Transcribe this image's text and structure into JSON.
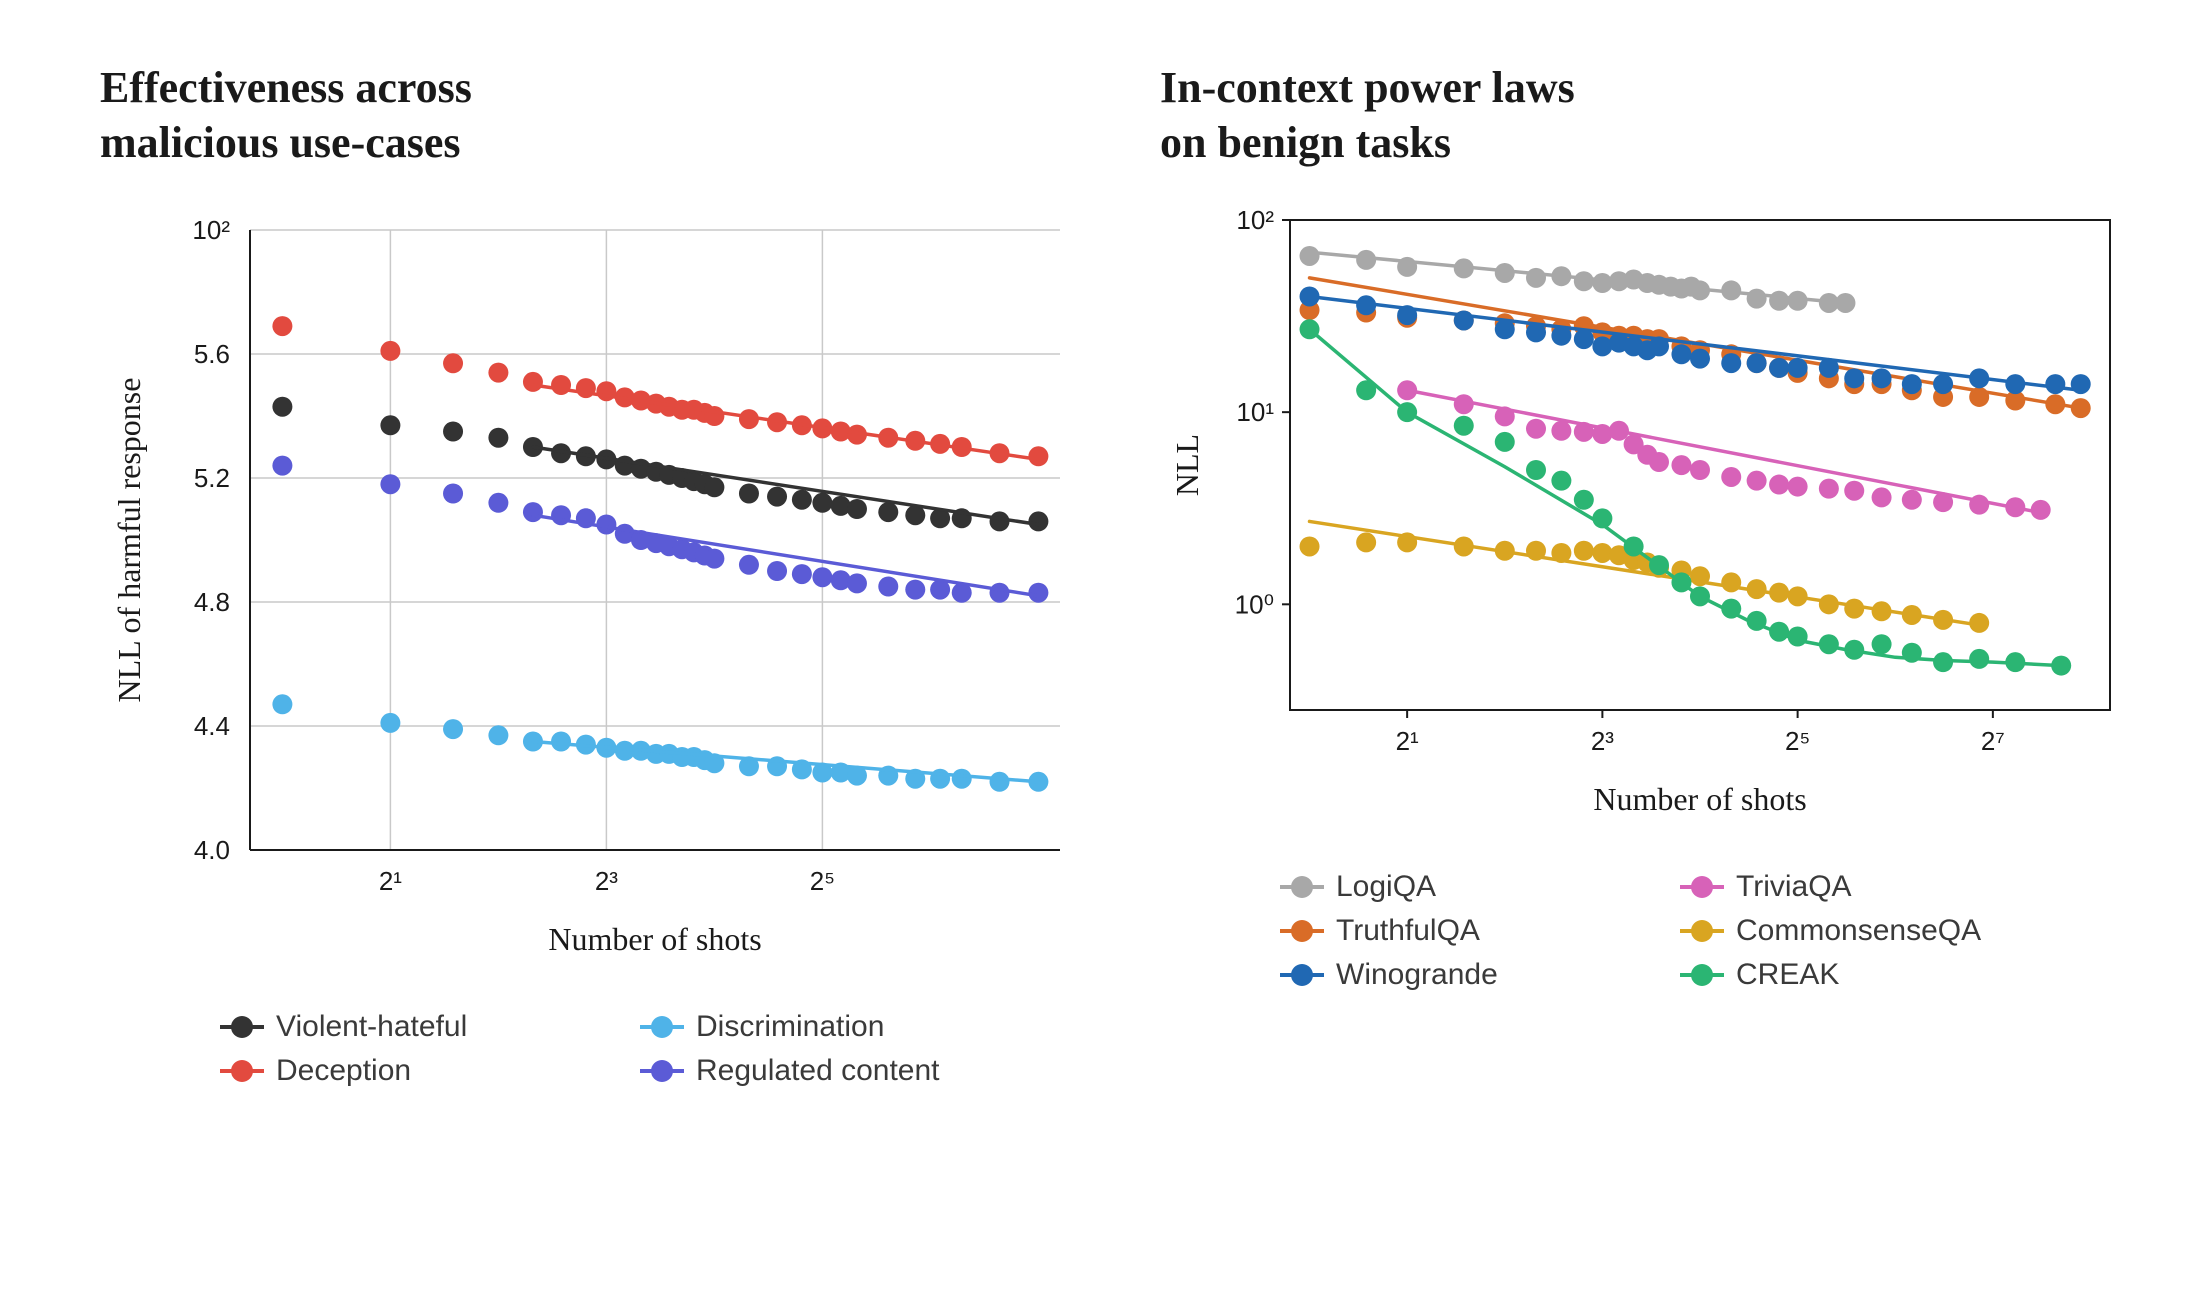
{
  "chart_data": [
    {
      "id": "left",
      "type": "scatter",
      "title": "Effectiveness across\nmalicious use-cases",
      "xlabel": "Number of shots",
      "ylabel": "NLL of harmful response",
      "x_scale": "log2",
      "y_scale": "linear",
      "x_ticks": [
        1,
        3,
        5
      ],
      "x_tick_labels": [
        "2¹",
        "2³",
        "2⁵"
      ],
      "y_ticks": [
        4.0,
        4.4,
        4.8,
        5.2,
        5.6
      ],
      "y_tick_labels": [
        "4.0",
        "4.4",
        "4.8",
        "5.2",
        "5.6"
      ],
      "y_top_label": "10²",
      "xlim_log2": [
        -0.3,
        7.2
      ],
      "ylim": [
        4.0,
        6.0
      ],
      "series": [
        {
          "name": "Deception",
          "color": "#e24a3f",
          "points_log2x": [
            0,
            1,
            1.58,
            2,
            2.32,
            2.58,
            2.81,
            3,
            3.17,
            3.32,
            3.46,
            3.58,
            3.7,
            3.81,
            3.91,
            4,
            4.32,
            4.58,
            4.81,
            5,
            5.17,
            5.32,
            5.61,
            5.86,
            6.09,
            6.29,
            6.64,
            7.0
          ],
          "y": [
            5.69,
            5.61,
            5.57,
            5.54,
            5.51,
            5.5,
            5.49,
            5.48,
            5.46,
            5.45,
            5.44,
            5.43,
            5.42,
            5.42,
            5.41,
            5.4,
            5.39,
            5.38,
            5.37,
            5.36,
            5.35,
            5.34,
            5.33,
            5.32,
            5.31,
            5.3,
            5.28,
            5.27
          ],
          "fit_from_log2x": 2.32,
          "fit_y_from": 5.5,
          "fit_to_log2x": 7.0,
          "fit_y_to": 5.26
        },
        {
          "name": "Violent-hateful",
          "color": "#333333",
          "points_log2x": [
            0,
            1,
            1.58,
            2,
            2.32,
            2.58,
            2.81,
            3,
            3.17,
            3.32,
            3.46,
            3.58,
            3.7,
            3.81,
            3.91,
            4,
            4.32,
            4.58,
            4.81,
            5,
            5.17,
            5.32,
            5.61,
            5.86,
            6.09,
            6.29,
            6.64,
            7.0
          ],
          "y": [
            5.43,
            5.37,
            5.35,
            5.33,
            5.3,
            5.28,
            5.27,
            5.26,
            5.24,
            5.23,
            5.22,
            5.21,
            5.2,
            5.19,
            5.18,
            5.17,
            5.15,
            5.14,
            5.13,
            5.12,
            5.11,
            5.1,
            5.09,
            5.08,
            5.07,
            5.07,
            5.06,
            5.06
          ],
          "fit_from_log2x": 2.32,
          "fit_y_from": 5.3,
          "fit_to_log2x": 7.0,
          "fit_y_to": 5.05
        },
        {
          "name": "Regulated content",
          "color": "#5b5bd6",
          "points_log2x": [
            0,
            1,
            1.58,
            2,
            2.32,
            2.58,
            2.81,
            3,
            3.17,
            3.32,
            3.46,
            3.58,
            3.7,
            3.81,
            3.91,
            4,
            4.32,
            4.58,
            4.81,
            5,
            5.17,
            5.32,
            5.61,
            5.86,
            6.09,
            6.29,
            6.64,
            7.0
          ],
          "y": [
            5.24,
            5.18,
            5.15,
            5.12,
            5.09,
            5.08,
            5.07,
            5.05,
            5.02,
            5.0,
            4.99,
            4.98,
            4.97,
            4.96,
            4.95,
            4.94,
            4.92,
            4.9,
            4.89,
            4.88,
            4.87,
            4.86,
            4.85,
            4.84,
            4.84,
            4.83,
            4.83,
            4.83
          ],
          "fit_from_log2x": 2.32,
          "fit_y_from": 5.08,
          "fit_to_log2x": 7.0,
          "fit_y_to": 4.82
        },
        {
          "name": "Discrimination",
          "color": "#4fb3e8",
          "points_log2x": [
            0,
            1,
            1.58,
            2,
            2.32,
            2.58,
            2.81,
            3,
            3.17,
            3.32,
            3.46,
            3.58,
            3.7,
            3.81,
            3.91,
            4,
            4.32,
            4.58,
            4.81,
            5,
            5.17,
            5.32,
            5.61,
            5.86,
            6.09,
            6.29,
            6.64,
            7.0
          ],
          "y": [
            4.47,
            4.41,
            4.39,
            4.37,
            4.35,
            4.35,
            4.34,
            4.33,
            4.32,
            4.32,
            4.31,
            4.31,
            4.3,
            4.3,
            4.29,
            4.28,
            4.27,
            4.27,
            4.26,
            4.25,
            4.25,
            4.24,
            4.24,
            4.23,
            4.23,
            4.23,
            4.22,
            4.22
          ],
          "fit_from_log2x": 2.32,
          "fit_y_from": 4.35,
          "fit_to_log2x": 7.0,
          "fit_y_to": 4.22
        }
      ],
      "legend": [
        {
          "label": "Violent-hateful",
          "color": "#333333"
        },
        {
          "label": "Discrimination",
          "color": "#4fb3e8"
        },
        {
          "label": "Deception",
          "color": "#e24a3f"
        },
        {
          "label": "Regulated content",
          "color": "#5b5bd6"
        }
      ]
    },
    {
      "id": "right",
      "type": "scatter",
      "title": "In-context power laws\non benign tasks",
      "xlabel": "Number of shots",
      "ylabel": "NLL",
      "x_scale": "log2",
      "y_scale": "log",
      "x_ticks": [
        1,
        3,
        5,
        7
      ],
      "x_tick_labels": [
        "2¹",
        "2³",
        "2⁵",
        "2⁷"
      ],
      "y_ticks_log10": [
        0,
        1,
        2
      ],
      "y_tick_labels": [
        "10⁰",
        "10¹",
        "10²"
      ],
      "xlim_log2": [
        -0.2,
        8.2
      ],
      "ylim_log10": [
        -0.55,
        2.0
      ],
      "series": [
        {
          "name": "LogiQA",
          "color": "#a8a8a8",
          "points_log2x": [
            0,
            0.58,
            1,
            1.58,
            2,
            2.32,
            2.58,
            2.81,
            3,
            3.17,
            3.32,
            3.46,
            3.58,
            3.7,
            3.81,
            3.91,
            4,
            4.32,
            4.58,
            4.81,
            5.0,
            5.32,
            5.49
          ],
          "y": [
            65,
            62,
            57,
            56,
            53,
            50,
            51,
            48,
            47,
            48,
            49,
            47,
            46,
            45,
            44,
            45,
            43,
            43,
            39,
            38,
            38,
            37,
            37
          ],
          "fit_from_log2x": 0,
          "fit_y_from": 68,
          "fit_to_log2x": 5.49,
          "fit_y_to": 37
        },
        {
          "name": "TruthfulQA",
          "color": "#d96c27",
          "points_log2x": [
            0,
            0.58,
            1,
            1.58,
            2,
            2.32,
            2.58,
            2.81,
            3,
            3.17,
            3.32,
            3.46,
            3.58,
            3.81,
            4,
            4.32,
            4.58,
            4.81,
            5,
            5.32,
            5.58,
            5.86,
            6.17,
            6.49,
            6.86,
            7.23,
            7.64,
            7.9
          ],
          "y": [
            34,
            33,
            31,
            30,
            29,
            28,
            27,
            28,
            26,
            25,
            25,
            24,
            24,
            22,
            21,
            20,
            18,
            17,
            16,
            15,
            14,
            14,
            13,
            12,
            12,
            11.5,
            11,
            10.5
          ],
          "fit_from_log2x": 0,
          "fit_y_from": 50,
          "fit_to_log2x": 7.9,
          "fit_y_to": 10.5
        },
        {
          "name": "Winogrande",
          "color": "#2068b3",
          "points_log2x": [
            0,
            0.58,
            1,
            1.58,
            2,
            2.32,
            2.58,
            2.81,
            3,
            3.17,
            3.32,
            3.46,
            3.58,
            3.81,
            4,
            4.32,
            4.58,
            4.81,
            5,
            5.32,
            5.58,
            5.86,
            6.17,
            6.49,
            6.86,
            7.23,
            7.64,
            7.9
          ],
          "y": [
            40,
            36,
            32,
            30,
            27,
            26,
            25,
            24,
            22,
            23,
            22,
            21,
            22,
            20,
            19,
            18,
            18,
            17,
            17,
            17,
            15,
            15,
            14,
            14,
            15,
            14,
            14,
            14
          ],
          "fit_from_log2x": 0,
          "fit_y_from": 40,
          "fit_to_log2x": 7.9,
          "fit_y_to": 13
        },
        {
          "name": "TriviaQA",
          "color": "#d762b8",
          "points_log2x": [
            1,
            1.58,
            2,
            2.32,
            2.58,
            2.81,
            3,
            3.17,
            3.32,
            3.46,
            3.58,
            3.81,
            4,
            4.32,
            4.58,
            4.81,
            5,
            5.32,
            5.58,
            5.86,
            6.17,
            6.49,
            6.86,
            7.23,
            7.49
          ],
          "y": [
            13,
            11,
            9.5,
            8.2,
            8.0,
            7.9,
            7.7,
            8.0,
            6.8,
            6.0,
            5.5,
            5.3,
            5.0,
            4.6,
            4.4,
            4.2,
            4.1,
            4.0,
            3.9,
            3.6,
            3.5,
            3.4,
            3.3,
            3.2,
            3.1
          ],
          "fit_from_log2x": 1,
          "fit_y_from": 13,
          "fit_to_log2x": 7.49,
          "fit_y_to": 3.0
        },
        {
          "name": "CommonsenseQA",
          "color": "#d9a521",
          "points_log2x": [
            0,
            0.58,
            1,
            1.58,
            2,
            2.32,
            2.58,
            2.81,
            3,
            3.17,
            3.32,
            3.46,
            3.58,
            3.81,
            4,
            4.32,
            4.58,
            4.81,
            5,
            5.32,
            5.58,
            5.86,
            6.17,
            6.49,
            6.86
          ],
          "y": [
            2.0,
            2.1,
            2.1,
            2.0,
            1.9,
            1.9,
            1.85,
            1.9,
            1.85,
            1.8,
            1.7,
            1.65,
            1.55,
            1.5,
            1.4,
            1.3,
            1.2,
            1.15,
            1.1,
            1.0,
            0.95,
            0.92,
            0.88,
            0.83,
            0.8
          ],
          "fit_from_log2x": 0,
          "fit_y_from": 2.7,
          "fit_to_log2x": 6.86,
          "fit_y_to": 0.78
        },
        {
          "name": "CREAK",
          "color": "#2bb573",
          "points_log2x": [
            0,
            0.58,
            1,
            1.58,
            2,
            2.32,
            2.58,
            2.81,
            3,
            3.32,
            3.58,
            3.81,
            4,
            4.32,
            4.58,
            4.81,
            5,
            5.32,
            5.58,
            5.86,
            6.17,
            6.49,
            6.86,
            7.23,
            7.7
          ],
          "y": [
            27,
            13,
            10,
            8.5,
            7.0,
            5.0,
            4.4,
            3.5,
            2.8,
            2.0,
            1.6,
            1.3,
            1.1,
            0.95,
            0.82,
            0.72,
            0.68,
            0.62,
            0.58,
            0.62,
            0.56,
            0.5,
            0.52,
            0.5,
            0.48
          ],
          "fit_curve": true,
          "fit_points": [
            [
              0,
              27
            ],
            [
              1,
              10
            ],
            [
              2,
              5.2
            ],
            [
              3,
              2.6
            ],
            [
              4,
              1.1
            ],
            [
              4.5,
              0.82
            ],
            [
              5,
              0.65
            ],
            [
              5.5,
              0.58
            ],
            [
              6,
              0.53
            ],
            [
              6.5,
              0.51
            ],
            [
              7,
              0.5
            ],
            [
              7.7,
              0.48
            ]
          ]
        }
      ],
      "legend": [
        {
          "label": "LogiQA",
          "color": "#a8a8a8"
        },
        {
          "label": "TriviaQA",
          "color": "#d762b8"
        },
        {
          "label": "TruthfulQA",
          "color": "#d96c27"
        },
        {
          "label": "CommonsenseQA",
          "color": "#d9a521"
        },
        {
          "label": "Winogrande",
          "color": "#2068b3"
        },
        {
          "label": "CREAK",
          "color": "#2bb573"
        }
      ]
    }
  ]
}
